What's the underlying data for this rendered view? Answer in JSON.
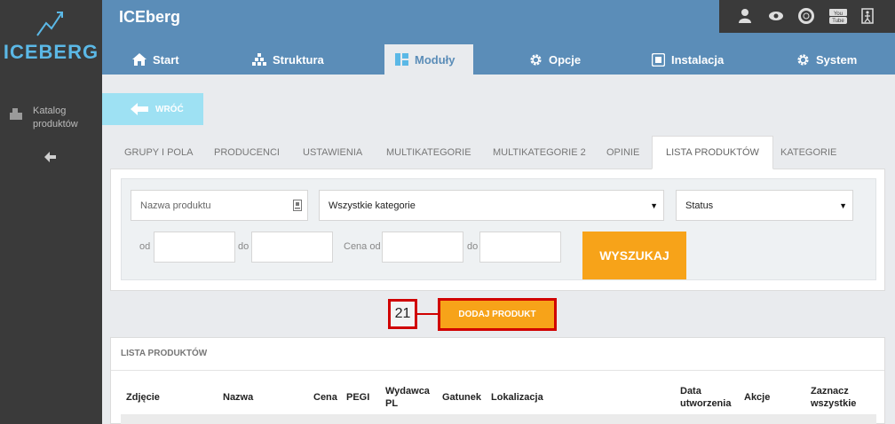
{
  "sidebar": {
    "logo_text": "ICEBERG",
    "items": [
      {
        "label": "Katalog produktów",
        "icon": "catalog-icon"
      }
    ],
    "back_icon": "arrow-left-icon"
  },
  "header": {
    "title": "ICEberg",
    "top_icons": [
      "user-icon",
      "eye-icon",
      "lifebuoy-icon",
      "youtube-icon",
      "logout-icon"
    ],
    "nav": [
      {
        "label": "Start",
        "icon": "home-icon"
      },
      {
        "label": "Struktura",
        "icon": "sitemap-icon"
      },
      {
        "label": "Moduły",
        "icon": "modules-icon",
        "active": true
      },
      {
        "label": "Opcje",
        "icon": "gear-icon"
      },
      {
        "label": "Instalacja",
        "icon": "install-icon"
      },
      {
        "label": "System",
        "icon": "gear-icon"
      }
    ]
  },
  "back_button": {
    "label": "WRÓĆ"
  },
  "tabs": [
    {
      "label": "GRUPY I POLA"
    },
    {
      "label": "PRODUCENCI"
    },
    {
      "label": "USTAWIENIA"
    },
    {
      "label": "MULTIKATEGORIE"
    },
    {
      "label": "MULTIKATEGORIE 2"
    },
    {
      "label": "OPINIE"
    },
    {
      "label": "LISTA PRODUKTÓW",
      "active": true
    },
    {
      "label": "KATEGORIE"
    }
  ],
  "filters": {
    "name_placeholder": "Nazwa produktu",
    "category_value": "Wszystkie kategorie",
    "status_value": "Status",
    "from_label": "od",
    "to_label": "do",
    "price_from_label": "Cena od",
    "price_to_label": "do",
    "search_label": "WYSZUKAJ"
  },
  "add_product": {
    "counter": "21",
    "label": "DODAJ PRODUKT"
  },
  "product_list": {
    "title": "LISTA PRODUKTÓW",
    "columns": {
      "image": "Zdjęcie",
      "name": "Nazwa",
      "price": "Cena",
      "pegi": "PEGI",
      "publisher_1": "Wydawca",
      "publisher_2": "PL",
      "genre": "Gatunek",
      "location": "Lokalizacja",
      "created_1": "Data",
      "created_2": "utworzenia",
      "actions": "Akcje",
      "select_1": "Zaznacz",
      "select_2": "wszystkie"
    }
  },
  "colors": {
    "header": "#5b8db8",
    "sidebar": "#3a3a3a",
    "accent_orange": "#f7a319",
    "back_button": "#9ee1f3",
    "highlight_red": "#d00000",
    "logo_blue": "#5bb8e6"
  }
}
